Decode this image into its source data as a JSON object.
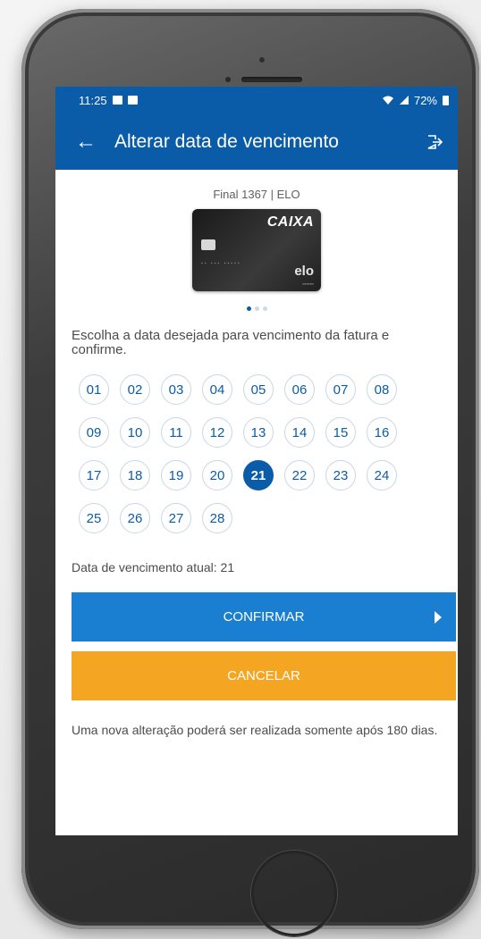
{
  "status_bar": {
    "time": "11:25",
    "battery": "72%"
  },
  "app_bar": {
    "back_icon": "arrow-left-icon",
    "title": "Alterar data de vencimento",
    "exit_icon": "logout-icon"
  },
  "card": {
    "label": "Final 1367 | ELO",
    "brand": "CAIXA",
    "network": "elo"
  },
  "carousel": {
    "count": 3,
    "active": 0
  },
  "instruction": "Escolha a data desejada para vencimento da fatura e confirme.",
  "days": [
    "01",
    "02",
    "03",
    "04",
    "05",
    "06",
    "07",
    "08",
    "09",
    "10",
    "11",
    "12",
    "13",
    "14",
    "15",
    "16",
    "17",
    "18",
    "19",
    "20",
    "21",
    "22",
    "23",
    "24",
    "25",
    "26",
    "27",
    "28"
  ],
  "selected_day": "21",
  "current_due": "Data de vencimento atual: 21",
  "buttons": {
    "confirm": "CONFIRMAR",
    "cancel": "CANCELAR"
  },
  "note": "Uma nova alteração poderá ser realizada somente após 180 dias.",
  "colors": {
    "primary": "#0b5ca8",
    "confirm": "#1a7fd1",
    "cancel": "#f4a623"
  }
}
